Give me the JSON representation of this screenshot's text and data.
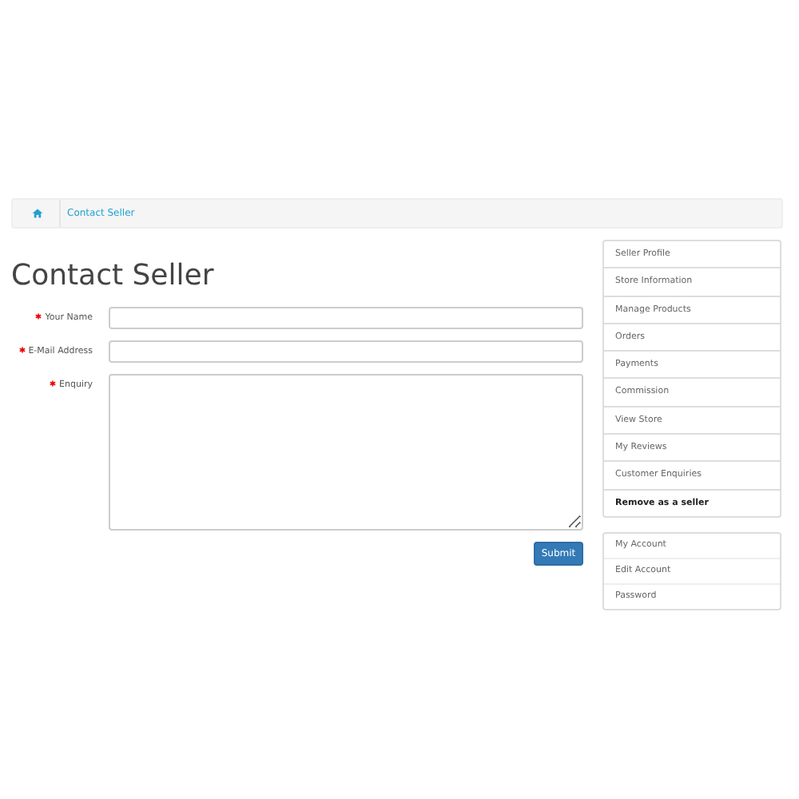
{
  "breadcrumb": [
    {
      "kind": "home"
    },
    {
      "kind": "link",
      "label": "Contact Seller"
    }
  ],
  "title": "Contact Seller",
  "form": {
    "fields": [
      {
        "label": "Your Name",
        "required": true,
        "kind": "input"
      },
      {
        "label": "E-Mail Address",
        "required": true,
        "kind": "input"
      },
      {
        "label": "Enquiry",
        "required": true,
        "kind": "textarea"
      }
    ],
    "submit": "Submit"
  },
  "seller_menu": [
    {
      "label": "Seller Profile",
      "kind": "link"
    },
    {
      "label": "Store Information",
      "kind": "link"
    },
    {
      "label": "Manage Products",
      "kind": "link"
    },
    {
      "label": "Orders",
      "kind": "link"
    },
    {
      "label": "Payments",
      "kind": "link"
    },
    {
      "label": "Commission",
      "kind": "link"
    },
    {
      "label": "View Store",
      "kind": "link"
    },
    {
      "label": "My Reviews",
      "kind": "link"
    },
    {
      "label": "Customer Enquiries",
      "kind": "link"
    },
    {
      "label": "Remove as a seller",
      "kind": "action"
    }
  ],
  "account_menu": [
    "My Account",
    "Edit Account",
    "Password"
  ]
}
